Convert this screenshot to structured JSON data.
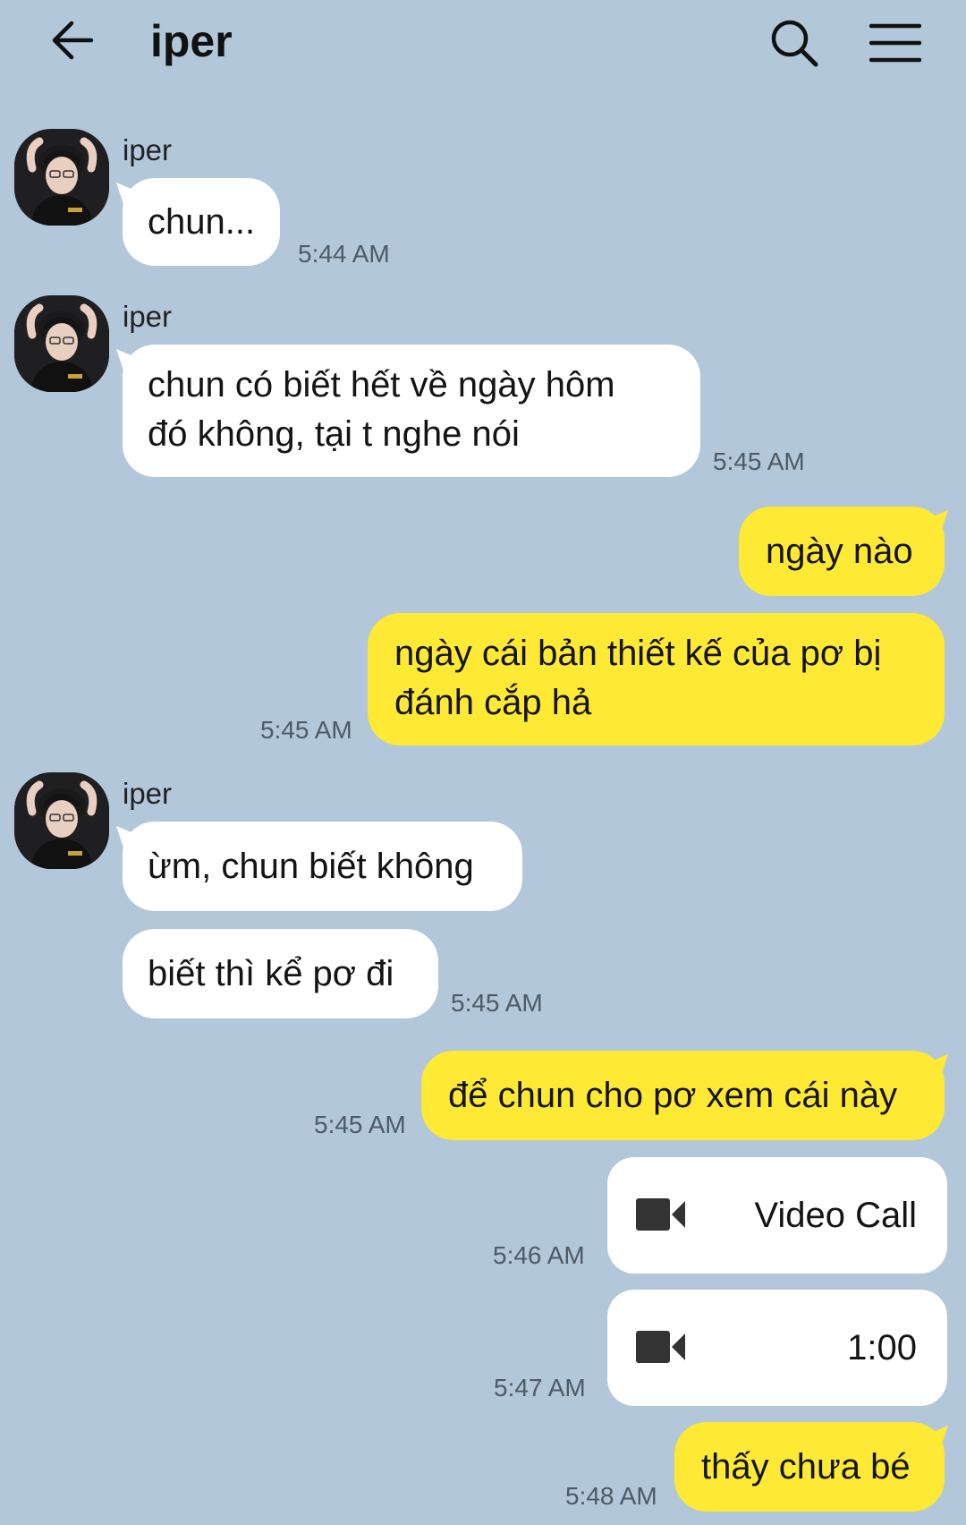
{
  "header": {
    "title": "iper",
    "back_icon": "arrow-left-icon",
    "search_icon": "search-icon",
    "menu_icon": "hamburger-menu-icon"
  },
  "colors": {
    "background": "#b2c7d9",
    "incoming_bubble": "#ffffff",
    "outgoing_bubble": "#fee934",
    "timestamp": "#4e5a66"
  },
  "messages": [
    {
      "direction": "in",
      "sender": "iper",
      "text": "chun...",
      "time": "5:44 AM"
    },
    {
      "direction": "in",
      "sender": "iper",
      "lines": [
        "chun có biết hết về ngày hôm",
        "đó không, tại t nghe nói"
      ],
      "time": "5:45 AM"
    },
    {
      "direction": "out",
      "text": "ngày nào"
    },
    {
      "direction": "out",
      "lines": [
        "ngày cái bản thiết kế của pơ bị",
        "đánh cắp hả"
      ],
      "time": "5:45 AM"
    },
    {
      "direction": "in",
      "sender": "iper",
      "text": "ừm, chun biết không"
    },
    {
      "direction": "in",
      "text": "biết thì kể pơ đi",
      "time": "5:45 AM"
    },
    {
      "direction": "out",
      "text": "để chun cho pơ xem cái này",
      "time": "5:45 AM"
    },
    {
      "direction": "out",
      "type": "call",
      "icon": "video-camera-icon",
      "label": "Video Call",
      "time": "5:46 AM"
    },
    {
      "direction": "out",
      "type": "call",
      "icon": "video-camera-icon",
      "label": "1:00",
      "time": "5:47 AM"
    },
    {
      "direction": "out",
      "text": "thấy chưa bé",
      "time": "5:48 AM"
    }
  ]
}
